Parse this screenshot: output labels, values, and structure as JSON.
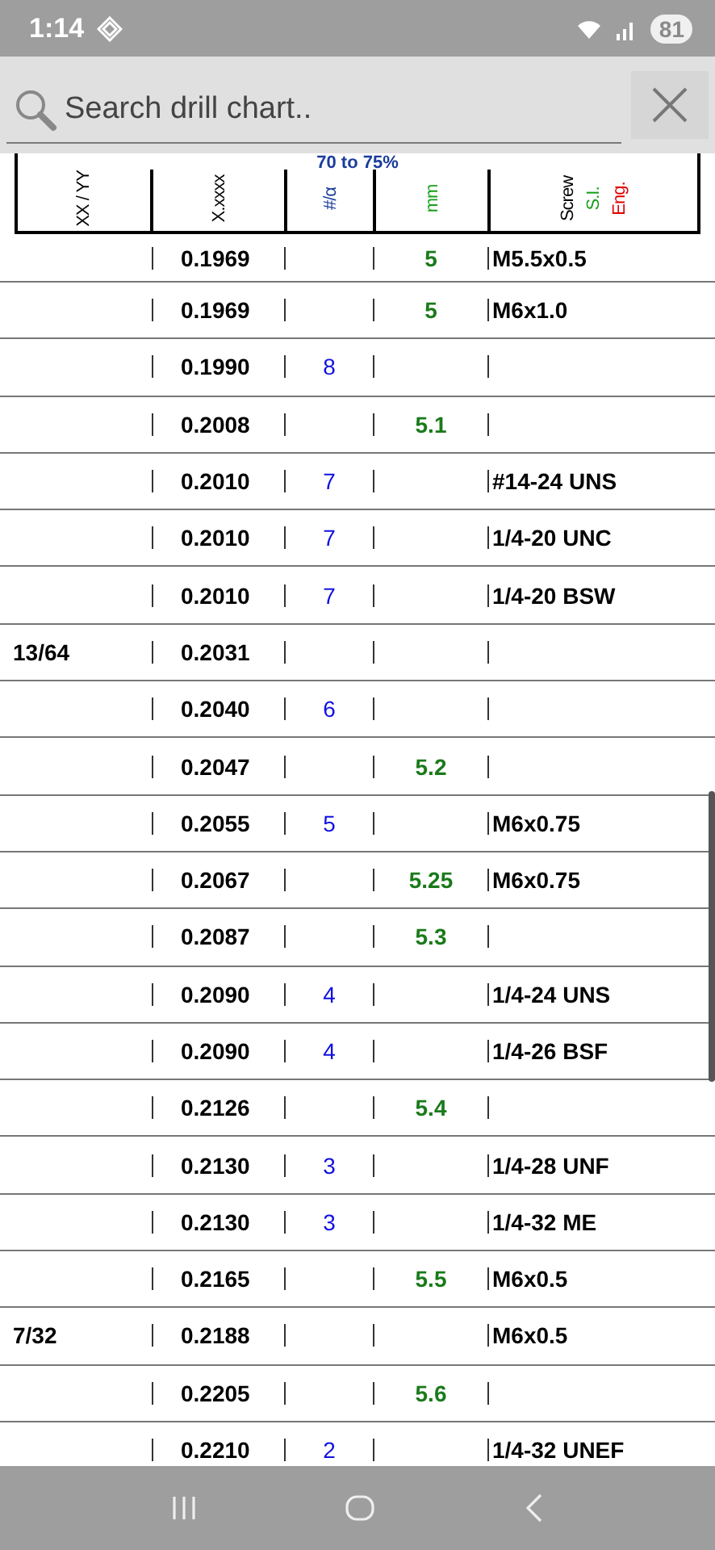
{
  "status_bar": {
    "time": "1:14",
    "battery": "81"
  },
  "search": {
    "placeholder": "Search drill chart.."
  },
  "header": {
    "title": "70 to 75%",
    "columns": [
      "XX / YY",
      "X.xxxx",
      "#/α",
      "mm"
    ],
    "screw": "Screw",
    "si": "S.I.",
    "eng": "Eng."
  },
  "rows": [
    {
      "fraction": "",
      "decimal": "0.1969",
      "number": "",
      "mm": "5",
      "screw": "M5.5x0.5"
    },
    {
      "fraction": "",
      "decimal": "0.1969",
      "number": "",
      "mm": "5",
      "screw": "M6x1.0"
    },
    {
      "fraction": "",
      "decimal": "0.1990",
      "number": "8",
      "mm": "",
      "screw": ""
    },
    {
      "fraction": "",
      "decimal": "0.2008",
      "number": "",
      "mm": "5.1",
      "screw": ""
    },
    {
      "fraction": "",
      "decimal": "0.2010",
      "number": "7",
      "mm": "",
      "screw": "#14-24 UNS"
    },
    {
      "fraction": "",
      "decimal": "0.2010",
      "number": "7",
      "mm": "",
      "screw": "1/4-20 UNC"
    },
    {
      "fraction": "",
      "decimal": "0.2010",
      "number": "7",
      "mm": "",
      "screw": "1/4-20 BSW"
    },
    {
      "fraction": "13/64",
      "decimal": "0.2031",
      "number": "",
      "mm": "",
      "screw": ""
    },
    {
      "fraction": "",
      "decimal": "0.2040",
      "number": "6",
      "mm": "",
      "screw": ""
    },
    {
      "fraction": "",
      "decimal": "0.2047",
      "number": "",
      "mm": "5.2",
      "screw": ""
    },
    {
      "fraction": "",
      "decimal": "0.2055",
      "number": "5",
      "mm": "",
      "screw": "M6x0.75"
    },
    {
      "fraction": "",
      "decimal": "0.2067",
      "number": "",
      "mm": "5.25",
      "screw": "M6x0.75"
    },
    {
      "fraction": "",
      "decimal": "0.2087",
      "number": "",
      "mm": "5.3",
      "screw": ""
    },
    {
      "fraction": "",
      "decimal": "0.2090",
      "number": "4",
      "mm": "",
      "screw": "1/4-24 UNS"
    },
    {
      "fraction": "",
      "decimal": "0.2090",
      "number": "4",
      "mm": "",
      "screw": "1/4-26 BSF"
    },
    {
      "fraction": "",
      "decimal": "0.2126",
      "number": "",
      "mm": "5.4",
      "screw": ""
    },
    {
      "fraction": "",
      "decimal": "0.2130",
      "number": "3",
      "mm": "",
      "screw": "1/4-28 UNF"
    },
    {
      "fraction": "",
      "decimal": "0.2130",
      "number": "3",
      "mm": "",
      "screw": "1/4-32 ME"
    },
    {
      "fraction": "",
      "decimal": "0.2165",
      "number": "",
      "mm": "5.5",
      "screw": "M6x0.5"
    },
    {
      "fraction": "7/32",
      "decimal": "0.2188",
      "number": "",
      "mm": "",
      "screw": "M6x0.5"
    },
    {
      "fraction": "",
      "decimal": "0.2205",
      "number": "",
      "mm": "5.6",
      "screw": ""
    },
    {
      "fraction": "",
      "decimal": "0.2210",
      "number": "2",
      "mm": "",
      "screw": "1/4-32 UNEF"
    }
  ]
}
